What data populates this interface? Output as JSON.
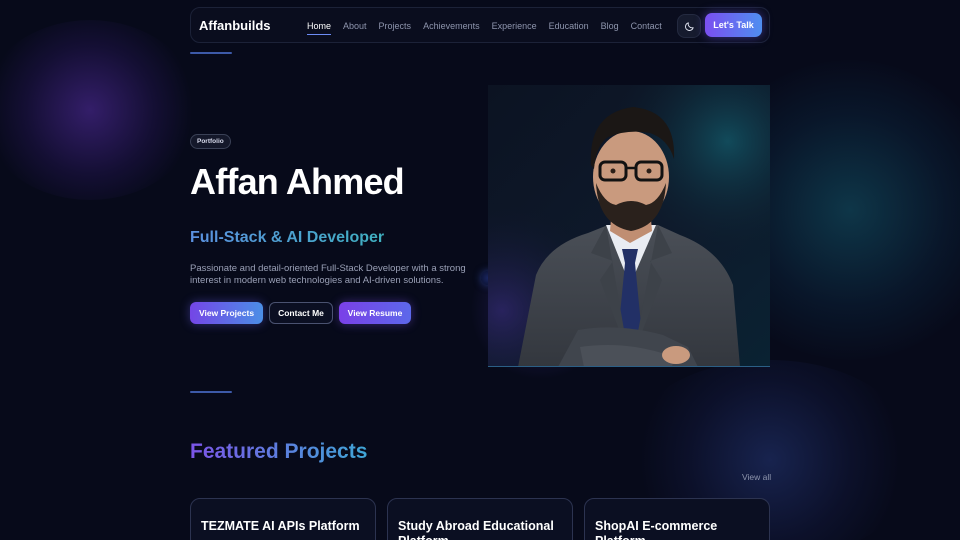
{
  "navbar": {
    "brand": "Affanbuilds",
    "links": [
      "Home",
      "About",
      "Projects",
      "Achievements",
      "Experience",
      "Education",
      "Blog",
      "Contact"
    ],
    "active": "Home",
    "theme_icon": "moon-icon",
    "cta_label": "Let's Talk"
  },
  "hero": {
    "badge": "Portfolio",
    "name": "Affan Ahmed",
    "role": "Full-Stack & AI Developer",
    "description": "Passionate and detail-oriented Full-Stack Developer with a strong interest in modern web technologies and AI-driven solutions.",
    "buttons": {
      "projects": "View Projects",
      "contact": "Contact Me",
      "resume": "View Resume"
    }
  },
  "featured": {
    "title": "Featured Projects",
    "view_all": "View all",
    "projects": [
      {
        "title": "TEZMATE AI APIs Platform"
      },
      {
        "title": "Study Abroad Educational Platform"
      },
      {
        "title": "ShopAI E-commerce Platform"
      }
    ]
  },
  "colors": {
    "background": "#070a1a",
    "accent_purple": "#7a4ff0",
    "accent_blue": "#4f8ef0",
    "accent_teal": "#3fb0c0"
  }
}
